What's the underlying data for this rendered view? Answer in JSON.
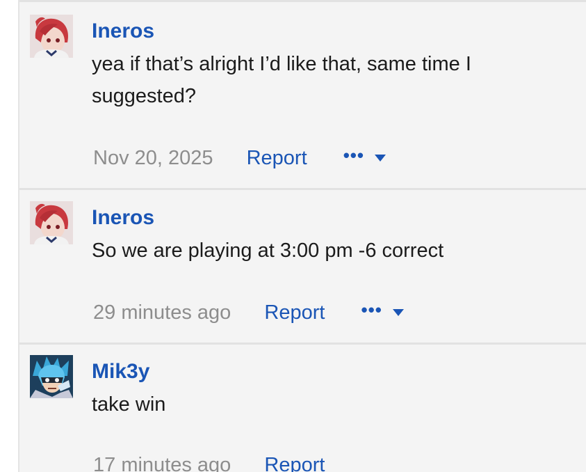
{
  "posts": [
    {
      "author": "Ineros",
      "message": "yea if that’s alright I’d like that, same time I suggested?",
      "timestamp": "Nov 20, 2025",
      "report_label": "Report",
      "more_label": "•••",
      "avatar_icon": "anime-girl-red-hair-icon"
    },
    {
      "author": "Ineros",
      "message": "So we are playing at 3:00 pm -6 correct",
      "timestamp": "29 minutes ago",
      "report_label": "Report",
      "more_label": "•••",
      "avatar_icon": "anime-girl-red-hair-icon"
    },
    {
      "author": "Mik3y",
      "message": "take win",
      "timestamp": "17 minutes ago",
      "report_label": "Report",
      "avatar_icon": "anime-boy-blue-hair-icon"
    }
  ],
  "colors": {
    "link": "#1a55b5",
    "text": "#1b1b1b",
    "muted": "#8d8d8d",
    "background": "#f4f4f4",
    "divider": "#e2e2e2"
  }
}
